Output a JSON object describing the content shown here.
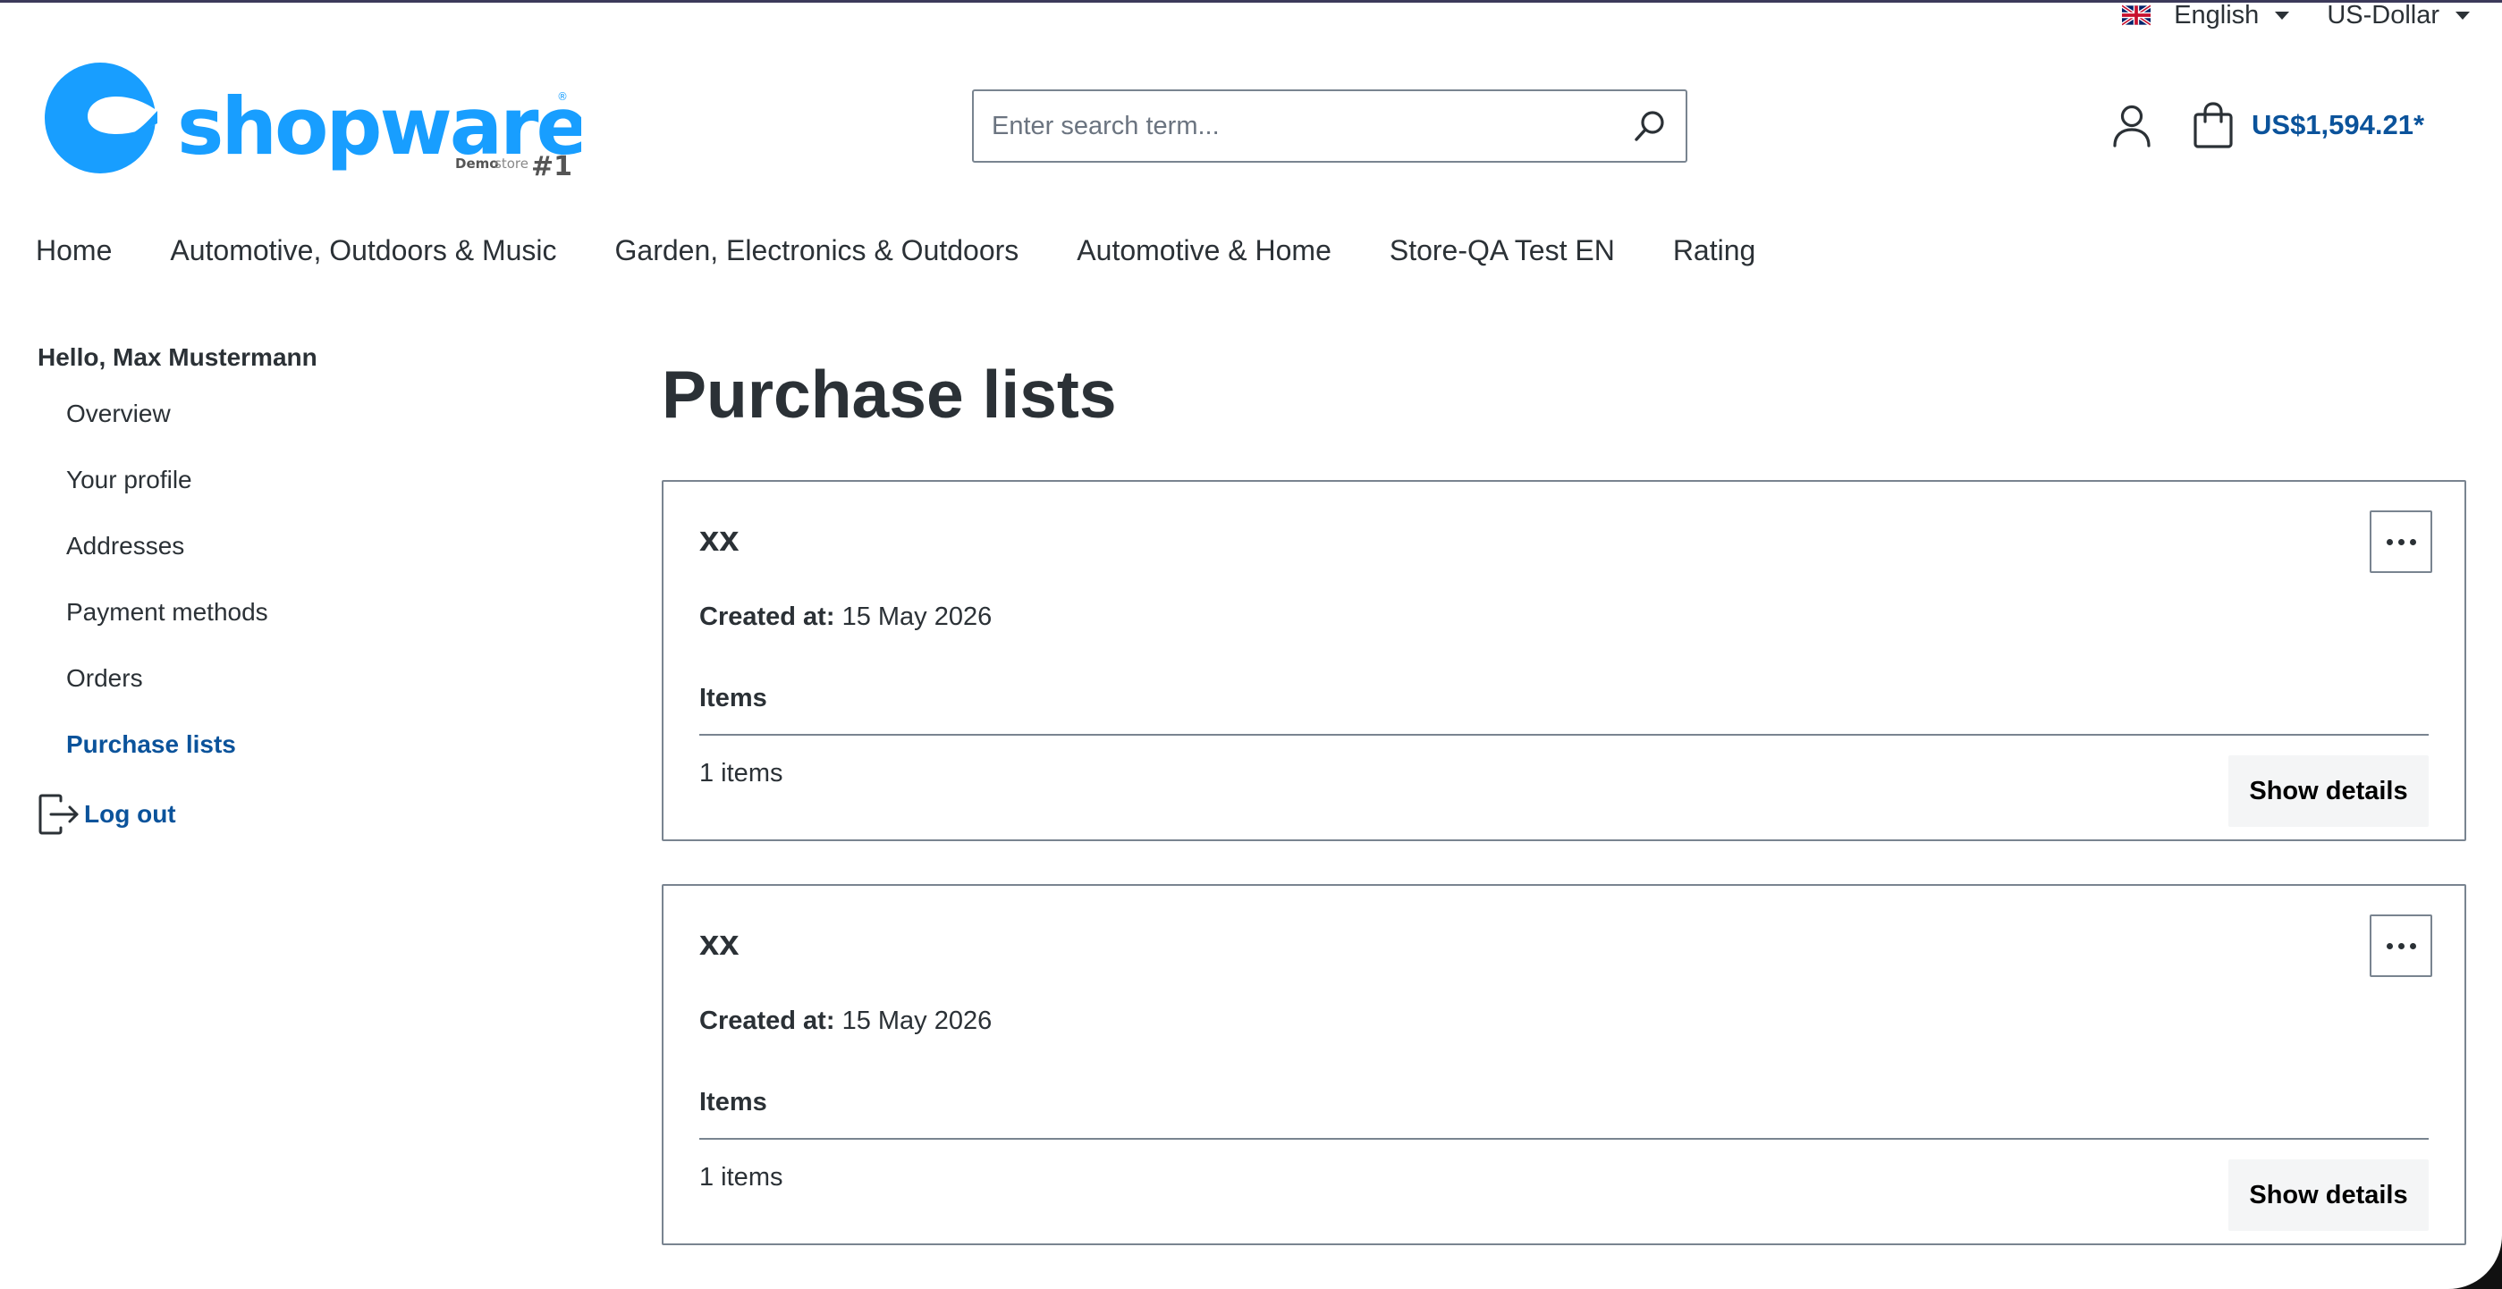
{
  "topbar": {
    "language_label": "English",
    "currency_label": "US-Dollar"
  },
  "logo": {
    "brand": "shopware",
    "sub_small": "Demo",
    "sub_small2": "store",
    "sub_num": "#1"
  },
  "search": {
    "placeholder": "Enter search term..."
  },
  "cart": {
    "amount": "US$1,594.21*"
  },
  "nav": {
    "items": [
      {
        "label": "Home"
      },
      {
        "label": "Automotive, Outdoors & Music"
      },
      {
        "label": "Garden, Electronics & Outdoors"
      },
      {
        "label": "Automotive & Home"
      },
      {
        "label": "Store-QA Test EN"
      },
      {
        "label": "Rating"
      }
    ]
  },
  "sidebar": {
    "greeting": "Hello, Max Mustermann",
    "items": [
      {
        "label": "Overview"
      },
      {
        "label": "Your profile"
      },
      {
        "label": "Addresses"
      },
      {
        "label": "Payment methods"
      },
      {
        "label": "Orders"
      },
      {
        "label": "Purchase lists"
      }
    ],
    "logout_label": "Log out"
  },
  "main": {
    "title": "Purchase lists",
    "lists": [
      {
        "name": "xx",
        "created_label": "Created at:",
        "created_value": "15 May 2026",
        "items_heading": "Items",
        "items_count": "1 items",
        "details_label": "Show details"
      },
      {
        "name": "xx",
        "created_label": "Created at:",
        "created_value": "15 May 2026",
        "items_heading": "Items",
        "items_count": "1 items",
        "details_label": "Show details"
      }
    ]
  },
  "colors": {
    "accent": "#0b539b",
    "logo_blue": "#189eff",
    "text": "#2b3136",
    "border": "#798490"
  }
}
